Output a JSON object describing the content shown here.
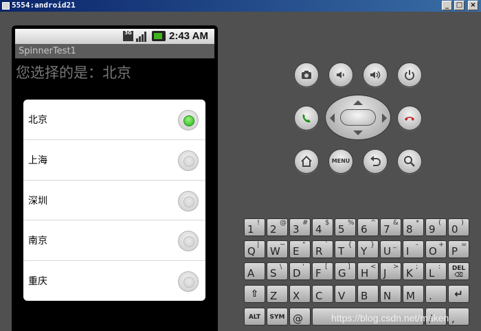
{
  "window": {
    "title": "5554:android21"
  },
  "statusbar": {
    "network": "3G",
    "time": "2:43 AM"
  },
  "app": {
    "title": "SpinnerTest1",
    "selected_text": "您选择的是：北京",
    "options": [
      {
        "label": "北京",
        "checked": true
      },
      {
        "label": "上海",
        "checked": false
      },
      {
        "label": "深圳",
        "checked": false
      },
      {
        "label": "南京",
        "checked": false
      },
      {
        "label": "重庆",
        "checked": false
      }
    ]
  },
  "controls": {
    "menu_label": "MENU",
    "buttons": [
      "camera-icon",
      "volume-down-icon",
      "volume-up-icon",
      "power-icon",
      "call-icon",
      "end-call-icon",
      "home-icon",
      "back-icon",
      "search-icon"
    ]
  },
  "keyboard": {
    "row1": [
      {
        "k": "1",
        "s": "!"
      },
      {
        "k": "2",
        "s": "@"
      },
      {
        "k": "3",
        "s": "#"
      },
      {
        "k": "4",
        "s": "$"
      },
      {
        "k": "5",
        "s": "%"
      },
      {
        "k": "6",
        "s": "^"
      },
      {
        "k": "7",
        "s": "&"
      },
      {
        "k": "8",
        "s": "*"
      },
      {
        "k": "9",
        "s": "("
      },
      {
        "k": "0",
        "s": ")"
      }
    ],
    "row2": [
      {
        "k": "Q",
        "s": "|"
      },
      {
        "k": "W",
        "s": "~"
      },
      {
        "k": "E",
        "s": "\""
      },
      {
        "k": "R",
        "s": "`"
      },
      {
        "k": "T",
        "s": "{"
      },
      {
        "k": "Y",
        "s": "}"
      },
      {
        "k": "U",
        "s": "_"
      },
      {
        "k": "I",
        "s": "-"
      },
      {
        "k": "O",
        "s": "+"
      },
      {
        "k": "P",
        "s": "="
      }
    ],
    "row3": [
      {
        "k": "A",
        "s": ""
      },
      {
        "k": "S",
        "s": "\\"
      },
      {
        "k": "D",
        "s": "'"
      },
      {
        "k": "F",
        "s": "["
      },
      {
        "k": "G",
        "s": "]"
      },
      {
        "k": "H",
        "s": "<"
      },
      {
        "k": "J",
        "s": ">"
      },
      {
        "k": "K",
        "s": ";"
      },
      {
        "k": "L",
        "s": ":"
      }
    ],
    "del_label": "DEL",
    "row4": [
      {
        "k": "Z",
        "s": ""
      },
      {
        "k": "X",
        "s": ""
      },
      {
        "k": "C",
        "s": ""
      },
      {
        "k": "V",
        "s": ""
      },
      {
        "k": "B",
        "s": ""
      },
      {
        "k": "N",
        "s": ""
      },
      {
        "k": "M",
        "s": ""
      },
      {
        "k": ".",
        "s": ""
      }
    ],
    "alt_label": "ALT",
    "sym_label": "SYM",
    "at_label": "@",
    "slash_label": "/",
    "comma_label": ","
  },
  "watermark": "https://blog.csdn.net/maken"
}
